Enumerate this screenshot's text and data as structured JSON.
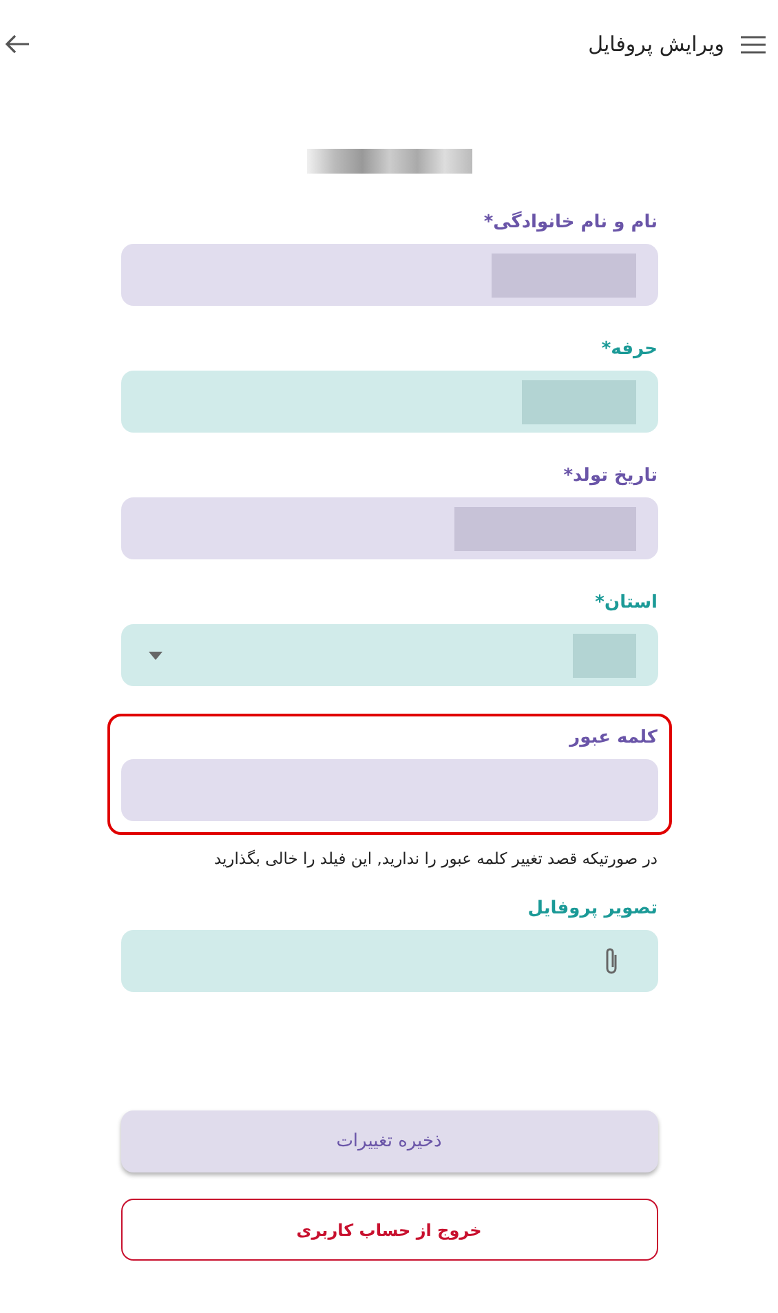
{
  "header": {
    "title": "ویرایش پروفایل"
  },
  "avatar": {
    "redacted": true
  },
  "fields": [
    {
      "label": "نام و نام خانوادگی*",
      "kind": "text",
      "color": "#6a55a8",
      "redacted": true,
      "highlighted": false
    },
    {
      "label": "حرفه*",
      "kind": "text",
      "color": "#1b9a97",
      "redacted": true,
      "highlighted": false
    },
    {
      "label": "تاریخ تولد*",
      "kind": "text",
      "color": "#6a55a8",
      "redacted": true,
      "highlighted": false
    },
    {
      "label": "استان*",
      "kind": "select",
      "color": "#1b9a97",
      "redacted": true,
      "highlighted": false
    },
    {
      "label": "کلمه عبور",
      "kind": "password",
      "color": "#6a55a8",
      "redacted": false,
      "highlighted": true,
      "hint": "در صورتیکه قصد تغییر کلمه عبور را ندارید, این فیلد را خالی بگذارید"
    },
    {
      "label": "تصویر پروفایل",
      "kind": "file",
      "color": "#1b9a97",
      "redacted": false,
      "highlighted": false
    }
  ],
  "save_button": {
    "label": "ذخیره تغییرات"
  },
  "logout_button": {
    "label": "خروج از حساب کاربری"
  }
}
